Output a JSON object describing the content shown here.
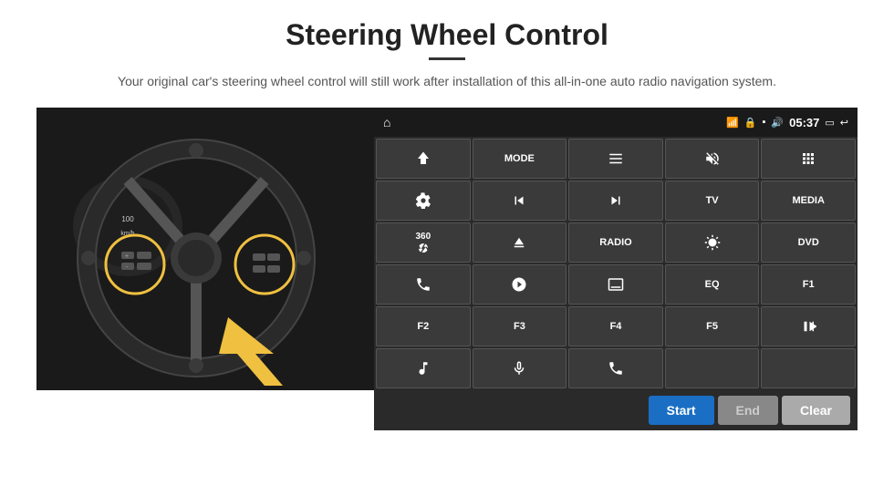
{
  "page": {
    "title": "Steering Wheel Control",
    "subtitle": "Your original car's steering wheel control will still work after installation of this all-in-one auto radio navigation system."
  },
  "status_bar": {
    "time": "05:37"
  },
  "control_buttons": [
    {
      "id": "nav-icon",
      "label": "",
      "type": "icon",
      "icon": "nav"
    },
    {
      "id": "mode-btn",
      "label": "MODE",
      "type": "text"
    },
    {
      "id": "list-icon",
      "label": "",
      "type": "icon",
      "icon": "list"
    },
    {
      "id": "mute-icon",
      "label": "",
      "type": "icon",
      "icon": "mute"
    },
    {
      "id": "apps-icon",
      "label": "",
      "type": "icon",
      "icon": "apps"
    },
    {
      "id": "settings-icon",
      "label": "",
      "type": "icon",
      "icon": "settings"
    },
    {
      "id": "prev-icon",
      "label": "",
      "type": "icon",
      "icon": "prev"
    },
    {
      "id": "next-icon",
      "label": "",
      "type": "icon",
      "icon": "next"
    },
    {
      "id": "tv-btn",
      "label": "TV",
      "type": "text"
    },
    {
      "id": "media-btn",
      "label": "MEDIA",
      "type": "text"
    },
    {
      "id": "cam-icon",
      "label": "360",
      "type": "text-icon"
    },
    {
      "id": "eject-icon",
      "label": "",
      "type": "icon",
      "icon": "eject"
    },
    {
      "id": "radio-btn",
      "label": "RADIO",
      "type": "text"
    },
    {
      "id": "brightness-icon",
      "label": "",
      "type": "icon",
      "icon": "brightness"
    },
    {
      "id": "dvd-btn",
      "label": "DVD",
      "type": "text"
    },
    {
      "id": "phone-icon",
      "label": "",
      "type": "icon",
      "icon": "phone"
    },
    {
      "id": "navi-icon",
      "label": "",
      "type": "icon",
      "icon": "navi"
    },
    {
      "id": "screen-icon",
      "label": "",
      "type": "icon",
      "icon": "screen"
    },
    {
      "id": "eq-btn",
      "label": "EQ",
      "type": "text"
    },
    {
      "id": "f1-btn",
      "label": "F1",
      "type": "text"
    },
    {
      "id": "f2-btn",
      "label": "F2",
      "type": "text"
    },
    {
      "id": "f3-btn",
      "label": "F3",
      "type": "text"
    },
    {
      "id": "f4-btn",
      "label": "F4",
      "type": "text"
    },
    {
      "id": "f5-btn",
      "label": "F5",
      "type": "text"
    },
    {
      "id": "playpause-icon",
      "label": "",
      "type": "icon",
      "icon": "playpause"
    },
    {
      "id": "music-icon",
      "label": "",
      "type": "icon",
      "icon": "music"
    },
    {
      "id": "mic-icon",
      "label": "",
      "type": "icon",
      "icon": "mic"
    },
    {
      "id": "call-icon",
      "label": "",
      "type": "icon",
      "icon": "call"
    },
    {
      "id": "empty1",
      "label": "",
      "type": "empty"
    },
    {
      "id": "empty2",
      "label": "",
      "type": "empty"
    }
  ],
  "action_bar": {
    "start_label": "Start",
    "end_label": "End",
    "clear_label": "Clear"
  }
}
